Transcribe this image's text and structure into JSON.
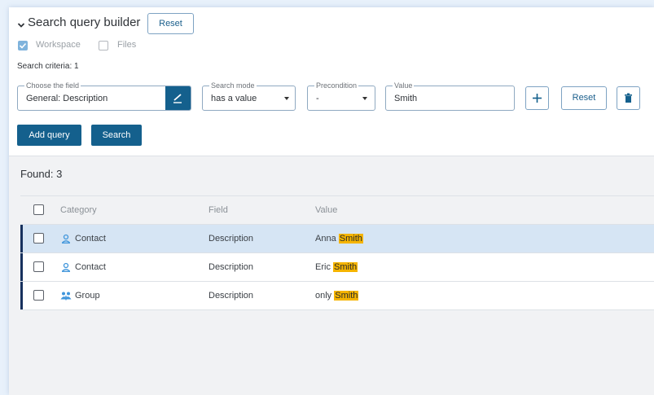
{
  "header": {
    "title": "Search query builder",
    "reset_label": "Reset"
  },
  "scope": {
    "workspace_label": "Workspace",
    "workspace_checked": true,
    "files_label": "Files",
    "files_checked": false
  },
  "criteria_label": "Search criteria: 1",
  "query": {
    "field": {
      "legend": "Choose the field",
      "value": "General: Description"
    },
    "mode": {
      "legend": "Search mode",
      "value": "has a value"
    },
    "precondition": {
      "legend": "Precondition",
      "value": "-"
    },
    "value": {
      "legend": "Value",
      "value": "Smith"
    },
    "reset_label": "Reset"
  },
  "actions": {
    "add_query_label": "Add query",
    "search_label": "Search"
  },
  "results": {
    "found_label": "Found: 3",
    "columns": [
      "Category",
      "Field",
      "Value"
    ],
    "rows": [
      {
        "category": "Contact",
        "icon": "contact-icon",
        "field": "Description",
        "value_prefix": "Anna ",
        "value_match": "Smith",
        "selected": true
      },
      {
        "category": "Contact",
        "icon": "contact-icon",
        "field": "Description",
        "value_prefix": "Eric ",
        "value_match": "Smith",
        "selected": false
      },
      {
        "category": "Group",
        "icon": "group-icon",
        "field": "Description",
        "value_prefix": "only ",
        "value_match": "Smith",
        "selected": false
      }
    ]
  },
  "colors": {
    "primary": "#14608d",
    "highlight": "#f5b400",
    "selected_row": "#d6e5f4",
    "selection_bar": "#17315e",
    "icon": "#3f95db"
  }
}
